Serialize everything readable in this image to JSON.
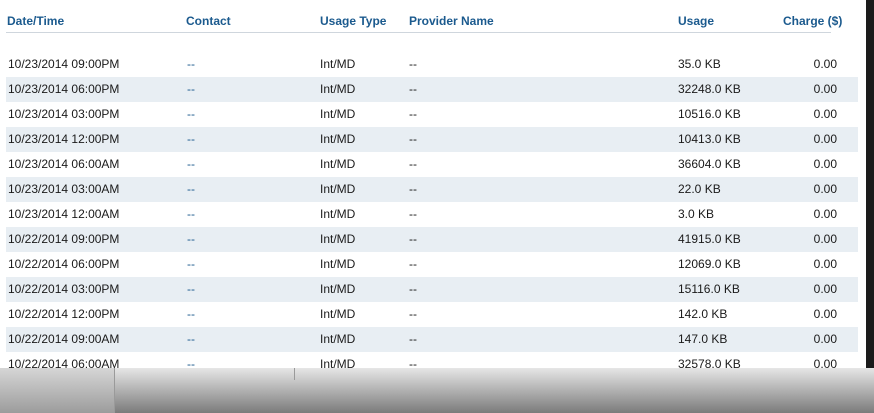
{
  "table": {
    "columns": [
      "Date/Time",
      "Contact",
      "Usage Type",
      "Provider Name",
      "Usage",
      "Charge ($)"
    ],
    "rows": [
      {
        "datetime": "10/23/2014 09:00PM",
        "contact": "--",
        "usage_type": "Int/MD",
        "provider": "--",
        "usage": "35.0 KB",
        "charge": "0.00"
      },
      {
        "datetime": "10/23/2014 06:00PM",
        "contact": "--",
        "usage_type": "Int/MD",
        "provider": "--",
        "usage": "32248.0 KB",
        "charge": "0.00"
      },
      {
        "datetime": "10/23/2014 03:00PM",
        "contact": "--",
        "usage_type": "Int/MD",
        "provider": "--",
        "usage": "10516.0 KB",
        "charge": "0.00"
      },
      {
        "datetime": "10/23/2014 12:00PM",
        "contact": "--",
        "usage_type": "Int/MD",
        "provider": "--",
        "usage": "10413.0 KB",
        "charge": "0.00"
      },
      {
        "datetime": "10/23/2014 06:00AM",
        "contact": "--",
        "usage_type": "Int/MD",
        "provider": "--",
        "usage": "36604.0 KB",
        "charge": "0.00"
      },
      {
        "datetime": "10/23/2014 03:00AM",
        "contact": "--",
        "usage_type": "Int/MD",
        "provider": "--",
        "usage": "22.0 KB",
        "charge": "0.00"
      },
      {
        "datetime": "10/23/2014 12:00AM",
        "contact": "--",
        "usage_type": "Int/MD",
        "provider": "--",
        "usage": "3.0 KB",
        "charge": "0.00"
      },
      {
        "datetime": "10/22/2014 09:00PM",
        "contact": "--",
        "usage_type": "Int/MD",
        "provider": "--",
        "usage": "41915.0 KB",
        "charge": "0.00"
      },
      {
        "datetime": "10/22/2014 06:00PM",
        "contact": "--",
        "usage_type": "Int/MD",
        "provider": "--",
        "usage": "12069.0 KB",
        "charge": "0.00"
      },
      {
        "datetime": "10/22/2014 03:00PM",
        "contact": "--",
        "usage_type": "Int/MD",
        "provider": "--",
        "usage": "15116.0 KB",
        "charge": "0.00"
      },
      {
        "datetime": "10/22/2014 12:00PM",
        "contact": "--",
        "usage_type": "Int/MD",
        "provider": "--",
        "usage": "142.0 KB",
        "charge": "0.00"
      },
      {
        "datetime": "10/22/2014 09:00AM",
        "contact": "--",
        "usage_type": "Int/MD",
        "provider": "--",
        "usage": "147.0 KB",
        "charge": "0.00"
      },
      {
        "datetime": "10/22/2014 06:00AM",
        "contact": "--",
        "usage_type": "Int/MD",
        "provider": "--",
        "usage": "32578.0 KB",
        "charge": "0.00"
      }
    ]
  },
  "colors": {
    "header_text": "#1b5a8e",
    "alt_row": "#e8eef3",
    "contact_link": "#1b5a8e"
  }
}
